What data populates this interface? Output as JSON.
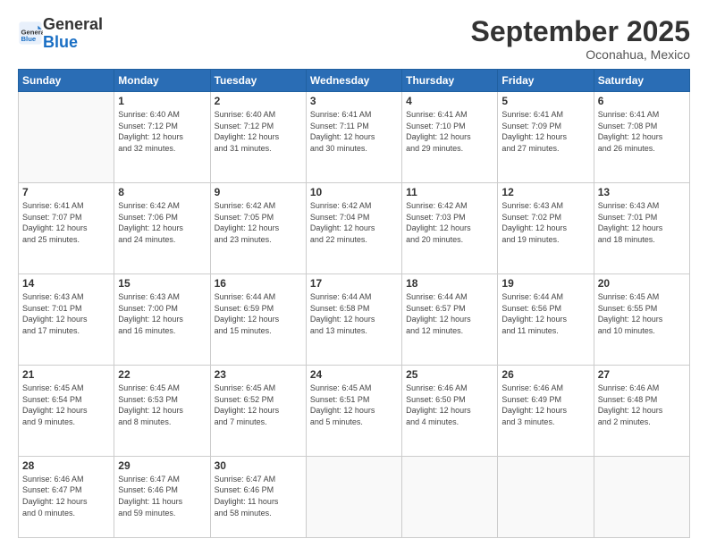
{
  "header": {
    "logo_line1": "General",
    "logo_line2": "Blue",
    "month": "September 2025",
    "location": "Oconahua, Mexico"
  },
  "weekdays": [
    "Sunday",
    "Monday",
    "Tuesday",
    "Wednesday",
    "Thursday",
    "Friday",
    "Saturday"
  ],
  "weeks": [
    [
      {
        "day": "",
        "info": ""
      },
      {
        "day": "1",
        "info": "Sunrise: 6:40 AM\nSunset: 7:12 PM\nDaylight: 12 hours\nand 32 minutes."
      },
      {
        "day": "2",
        "info": "Sunrise: 6:40 AM\nSunset: 7:12 PM\nDaylight: 12 hours\nand 31 minutes."
      },
      {
        "day": "3",
        "info": "Sunrise: 6:41 AM\nSunset: 7:11 PM\nDaylight: 12 hours\nand 30 minutes."
      },
      {
        "day": "4",
        "info": "Sunrise: 6:41 AM\nSunset: 7:10 PM\nDaylight: 12 hours\nand 29 minutes."
      },
      {
        "day": "5",
        "info": "Sunrise: 6:41 AM\nSunset: 7:09 PM\nDaylight: 12 hours\nand 27 minutes."
      },
      {
        "day": "6",
        "info": "Sunrise: 6:41 AM\nSunset: 7:08 PM\nDaylight: 12 hours\nand 26 minutes."
      }
    ],
    [
      {
        "day": "7",
        "info": "Sunrise: 6:41 AM\nSunset: 7:07 PM\nDaylight: 12 hours\nand 25 minutes."
      },
      {
        "day": "8",
        "info": "Sunrise: 6:42 AM\nSunset: 7:06 PM\nDaylight: 12 hours\nand 24 minutes."
      },
      {
        "day": "9",
        "info": "Sunrise: 6:42 AM\nSunset: 7:05 PM\nDaylight: 12 hours\nand 23 minutes."
      },
      {
        "day": "10",
        "info": "Sunrise: 6:42 AM\nSunset: 7:04 PM\nDaylight: 12 hours\nand 22 minutes."
      },
      {
        "day": "11",
        "info": "Sunrise: 6:42 AM\nSunset: 7:03 PM\nDaylight: 12 hours\nand 20 minutes."
      },
      {
        "day": "12",
        "info": "Sunrise: 6:43 AM\nSunset: 7:02 PM\nDaylight: 12 hours\nand 19 minutes."
      },
      {
        "day": "13",
        "info": "Sunrise: 6:43 AM\nSunset: 7:01 PM\nDaylight: 12 hours\nand 18 minutes."
      }
    ],
    [
      {
        "day": "14",
        "info": "Sunrise: 6:43 AM\nSunset: 7:01 PM\nDaylight: 12 hours\nand 17 minutes."
      },
      {
        "day": "15",
        "info": "Sunrise: 6:43 AM\nSunset: 7:00 PM\nDaylight: 12 hours\nand 16 minutes."
      },
      {
        "day": "16",
        "info": "Sunrise: 6:44 AM\nSunset: 6:59 PM\nDaylight: 12 hours\nand 15 minutes."
      },
      {
        "day": "17",
        "info": "Sunrise: 6:44 AM\nSunset: 6:58 PM\nDaylight: 12 hours\nand 13 minutes."
      },
      {
        "day": "18",
        "info": "Sunrise: 6:44 AM\nSunset: 6:57 PM\nDaylight: 12 hours\nand 12 minutes."
      },
      {
        "day": "19",
        "info": "Sunrise: 6:44 AM\nSunset: 6:56 PM\nDaylight: 12 hours\nand 11 minutes."
      },
      {
        "day": "20",
        "info": "Sunrise: 6:45 AM\nSunset: 6:55 PM\nDaylight: 12 hours\nand 10 minutes."
      }
    ],
    [
      {
        "day": "21",
        "info": "Sunrise: 6:45 AM\nSunset: 6:54 PM\nDaylight: 12 hours\nand 9 minutes."
      },
      {
        "day": "22",
        "info": "Sunrise: 6:45 AM\nSunset: 6:53 PM\nDaylight: 12 hours\nand 8 minutes."
      },
      {
        "day": "23",
        "info": "Sunrise: 6:45 AM\nSunset: 6:52 PM\nDaylight: 12 hours\nand 7 minutes."
      },
      {
        "day": "24",
        "info": "Sunrise: 6:45 AM\nSunset: 6:51 PM\nDaylight: 12 hours\nand 5 minutes."
      },
      {
        "day": "25",
        "info": "Sunrise: 6:46 AM\nSunset: 6:50 PM\nDaylight: 12 hours\nand 4 minutes."
      },
      {
        "day": "26",
        "info": "Sunrise: 6:46 AM\nSunset: 6:49 PM\nDaylight: 12 hours\nand 3 minutes."
      },
      {
        "day": "27",
        "info": "Sunrise: 6:46 AM\nSunset: 6:48 PM\nDaylight: 12 hours\nand 2 minutes."
      }
    ],
    [
      {
        "day": "28",
        "info": "Sunrise: 6:46 AM\nSunset: 6:47 PM\nDaylight: 12 hours\nand 0 minutes."
      },
      {
        "day": "29",
        "info": "Sunrise: 6:47 AM\nSunset: 6:46 PM\nDaylight: 11 hours\nand 59 minutes."
      },
      {
        "day": "30",
        "info": "Sunrise: 6:47 AM\nSunset: 6:46 PM\nDaylight: 11 hours\nand 58 minutes."
      },
      {
        "day": "",
        "info": ""
      },
      {
        "day": "",
        "info": ""
      },
      {
        "day": "",
        "info": ""
      },
      {
        "day": "",
        "info": ""
      }
    ]
  ]
}
